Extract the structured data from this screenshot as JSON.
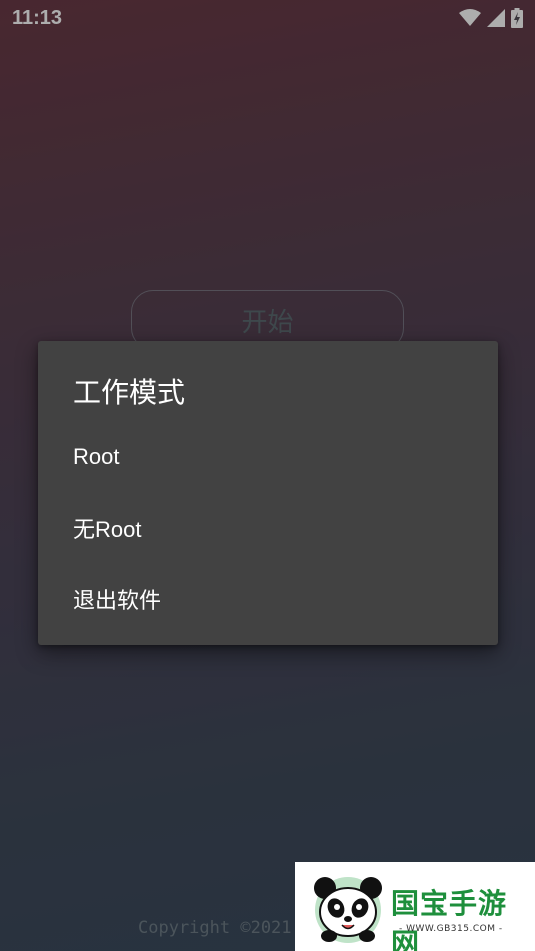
{
  "status_bar": {
    "time": "11:13",
    "icons": [
      "wifi-icon",
      "cellular-signal-icon",
      "battery-charging-icon"
    ]
  },
  "main": {
    "start_label": "开始",
    "copyright": "Copyright ©2021"
  },
  "dialog": {
    "title": "工作模式",
    "items": [
      "Root",
      "无Root",
      "退出软件"
    ]
  },
  "watermark": {
    "name": "国宝手游网",
    "url": "- WWW.GB315.COM -"
  },
  "colors": {
    "dialog_background": "#424242",
    "watermark_green": "#1e8f3c"
  }
}
